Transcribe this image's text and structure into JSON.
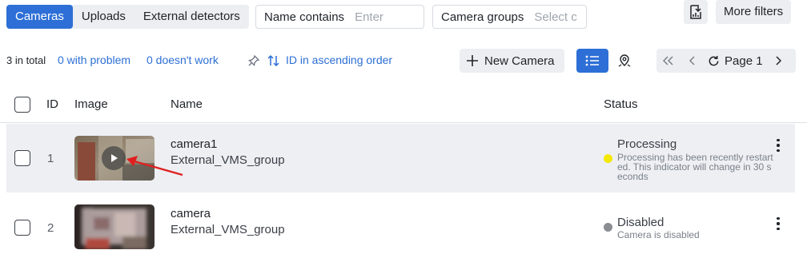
{
  "tabs": [
    {
      "label": "Cameras",
      "active": true
    },
    {
      "label": "Uploads",
      "active": false
    },
    {
      "label": "External detectors",
      "active": false
    }
  ],
  "filters": {
    "name": {
      "label": "Name contains",
      "placeholder": "Enter"
    },
    "groups": {
      "label": "Camera groups",
      "placeholder": "Select c..."
    }
  },
  "toolbar": {
    "export_icon": "download-report-icon",
    "more_filters": "More filters"
  },
  "summary": {
    "total": "3 in total",
    "with_problem": "0 with problem",
    "not_working": "0 doesn't work",
    "pin_icon": "pin-icon",
    "sort_icon": "sort-arrows-icon",
    "sort_label": "ID in ascending order"
  },
  "actions": {
    "new_camera": "New Camera",
    "list_view_icon": "list-view-icon",
    "map_view_icon": "map-pin-icon"
  },
  "pager": {
    "page_label": "Page 1"
  },
  "table": {
    "headers": {
      "id": "ID",
      "image": "Image",
      "name": "Name",
      "status": "Status"
    },
    "rows": [
      {
        "id": "1",
        "name": "camera1",
        "group": "External_VMS_group",
        "status": "Processing",
        "status_desc": "Processing has been recently restarted. This indicator will change in 30 seconds",
        "status_color": "#f5e800"
      },
      {
        "id": "2",
        "name": "camera",
        "group": "External_VMS_group",
        "status": "Disabled",
        "status_desc": "Camera is disabled",
        "status_color": "#8a8d92"
      }
    ]
  },
  "colors": {
    "accent": "#2d6fd6",
    "annotation_arrow": "#e02020"
  }
}
